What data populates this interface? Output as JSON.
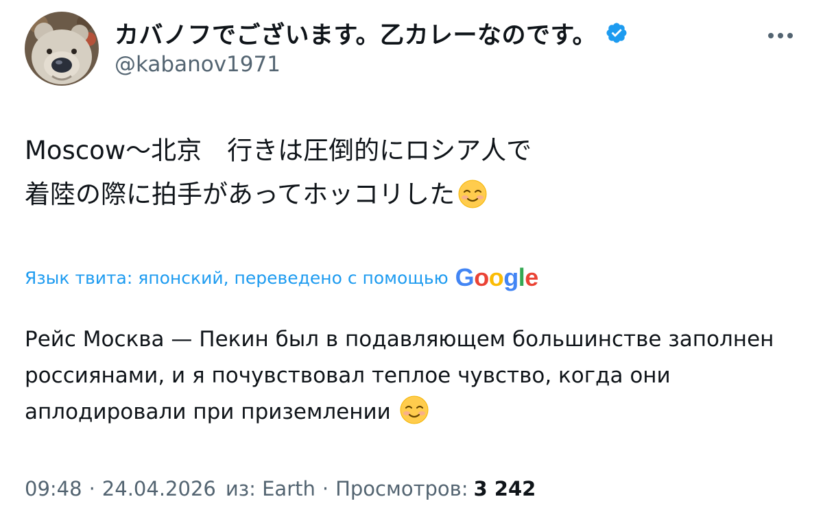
{
  "tweet": {
    "author": {
      "display_name": "カバノフでございます。乙カレーなのです。",
      "handle": "@kabanov1971",
      "verified": true,
      "avatar": "teddy-bear-avatar"
    },
    "original_text": "Moscow〜北京　行きは圧倒的にロシア人で\n着陸の際に拍手があってホッコリした",
    "original_emoji": "smiling-face-icon",
    "translation_note": "Язык твита: японский, переведено с помощью",
    "translation_provider": "Google",
    "translated_text": "Рейс Москва — Пекин был в подавляющем большинстве заполнен россиянами, и я почувствовал теплое чувство, когда они аплодировали при приземлении",
    "time": "09:48",
    "date": "24.04.2026",
    "source": "из: Earth",
    "views_label": "Просмотров:",
    "views_count": "3 242",
    "separator": "·"
  },
  "colors": {
    "text": "#0f1419",
    "secondary": "#536471",
    "accent": "#1d9bf0",
    "verified_badge": "#1d9bf0"
  }
}
